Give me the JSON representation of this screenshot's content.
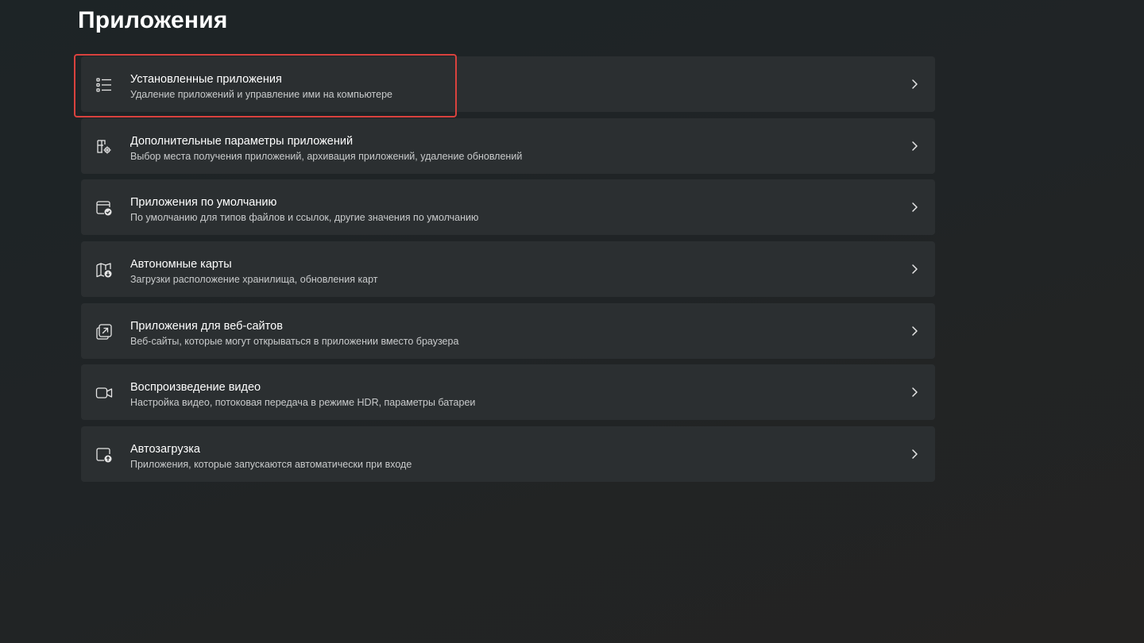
{
  "page": {
    "title": "Приложения"
  },
  "items": [
    {
      "title": "Установленные приложения",
      "subtitle": "Удаление приложений и управление ими на компьютере",
      "icon": "installed-apps-list-icon",
      "highlighted": true
    },
    {
      "title": "Дополнительные параметры приложений",
      "subtitle": "Выбор места получения приложений, архивация приложений, удаление обновлений",
      "icon": "advanced-app-settings-icon"
    },
    {
      "title": "Приложения по умолчанию",
      "subtitle": "По умолчанию для типов файлов и ссылок, другие значения по умолчанию",
      "icon": "default-apps-icon"
    },
    {
      "title": "Автономные карты",
      "subtitle": "Загрузки расположение хранилища, обновления карт",
      "icon": "offline-maps-icon"
    },
    {
      "title": "Приложения для веб-сайтов",
      "subtitle": "Веб-сайты, которые могут открываться в приложении вместо браузера",
      "icon": "apps-for-websites-icon"
    },
    {
      "title": "Воспроизведение видео",
      "subtitle": "Настройка видео, потоковая передача в режиме HDR, параметры батареи",
      "icon": "video-playback-icon"
    },
    {
      "title": "Автозагрузка",
      "subtitle": "Приложения, которые запускаются автоматически при входе",
      "icon": "startup-icon"
    }
  ],
  "colors": {
    "background": "#202426",
    "card": "#2b2f31",
    "highlight_border": "#d9423e",
    "title_text": "#ffffff",
    "subtitle_text": "#c9cbcc"
  }
}
